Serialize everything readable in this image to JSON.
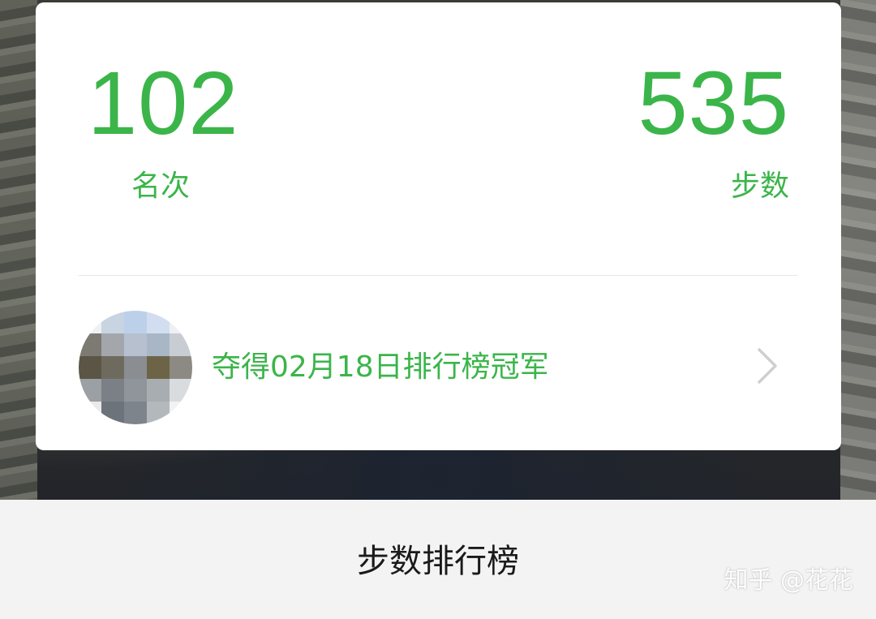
{
  "stats": {
    "rank_value": "102",
    "rank_label": "名次",
    "steps_value": "535",
    "steps_label": "步数"
  },
  "champion": {
    "text": "夺得02月18日排行榜冠军",
    "arrow_icon": "chevron-right-icon"
  },
  "footer": {
    "title": "步数排行榜"
  },
  "watermark": "知乎 @花花",
  "colors": {
    "accent_green": "#3bb54a",
    "card_bg": "#ffffff",
    "footer_bg": "#f3f3f3",
    "footer_text": "#1a1a1a"
  }
}
